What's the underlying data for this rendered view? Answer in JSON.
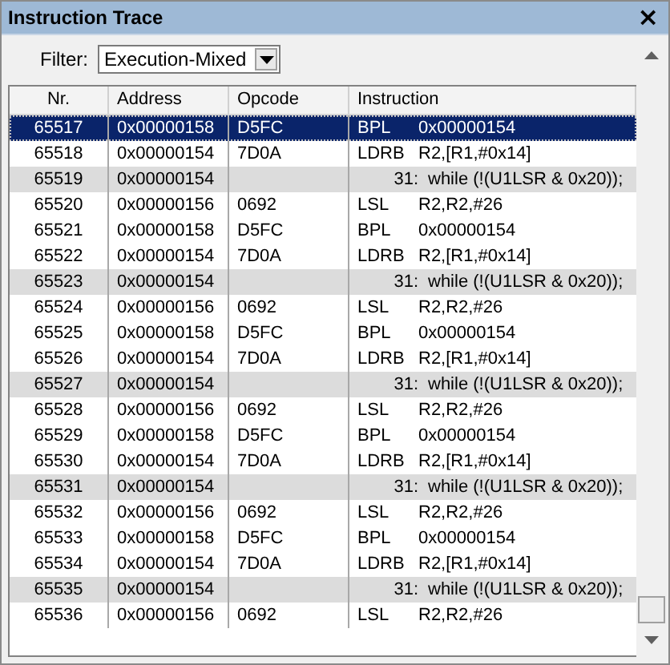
{
  "window": {
    "title": "Instruction Trace",
    "close": "×"
  },
  "filter": {
    "label": "Filter:",
    "value": "Execution-Mixed"
  },
  "table": {
    "columns": [
      "Nr.",
      "Address",
      "Opcode",
      "Instruction"
    ],
    "rows": [
      {
        "kind": "instr",
        "selected": true,
        "nr": "65517",
        "address": "0x00000158",
        "opcode": "D5FC",
        "mnemonic": "BPL",
        "operands": "0x00000154"
      },
      {
        "kind": "instr",
        "selected": false,
        "nr": "65518",
        "address": "0x00000154",
        "opcode": "7D0A",
        "mnemonic": "LDRB",
        "operands": "R2,[R1,#0x14]"
      },
      {
        "kind": "source",
        "selected": false,
        "nr": "65519",
        "address": "0x00000154",
        "line": "31:",
        "code": "while (!(U1LSR & 0x20));"
      },
      {
        "kind": "instr",
        "selected": false,
        "nr": "65520",
        "address": "0x00000156",
        "opcode": "0692",
        "mnemonic": "LSL",
        "operands": "R2,R2,#26"
      },
      {
        "kind": "instr",
        "selected": false,
        "nr": "65521",
        "address": "0x00000158",
        "opcode": "D5FC",
        "mnemonic": "BPL",
        "operands": "0x00000154"
      },
      {
        "kind": "instr",
        "selected": false,
        "nr": "65522",
        "address": "0x00000154",
        "opcode": "7D0A",
        "mnemonic": "LDRB",
        "operands": "R2,[R1,#0x14]"
      },
      {
        "kind": "source",
        "selected": false,
        "nr": "65523",
        "address": "0x00000154",
        "line": "31:",
        "code": "while (!(U1LSR & 0x20));"
      },
      {
        "kind": "instr",
        "selected": false,
        "nr": "65524",
        "address": "0x00000156",
        "opcode": "0692",
        "mnemonic": "LSL",
        "operands": "R2,R2,#26"
      },
      {
        "kind": "instr",
        "selected": false,
        "nr": "65525",
        "address": "0x00000158",
        "opcode": "D5FC",
        "mnemonic": "BPL",
        "operands": "0x00000154"
      },
      {
        "kind": "instr",
        "selected": false,
        "nr": "65526",
        "address": "0x00000154",
        "opcode": "7D0A",
        "mnemonic": "LDRB",
        "operands": "R2,[R1,#0x14]"
      },
      {
        "kind": "source",
        "selected": false,
        "nr": "65527",
        "address": "0x00000154",
        "line": "31:",
        "code": "while (!(U1LSR & 0x20));"
      },
      {
        "kind": "instr",
        "selected": false,
        "nr": "65528",
        "address": "0x00000156",
        "opcode": "0692",
        "mnemonic": "LSL",
        "operands": "R2,R2,#26"
      },
      {
        "kind": "instr",
        "selected": false,
        "nr": "65529",
        "address": "0x00000158",
        "opcode": "D5FC",
        "mnemonic": "BPL",
        "operands": "0x00000154"
      },
      {
        "kind": "instr",
        "selected": false,
        "nr": "65530",
        "address": "0x00000154",
        "opcode": "7D0A",
        "mnemonic": "LDRB",
        "operands": "R2,[R1,#0x14]"
      },
      {
        "kind": "source",
        "selected": false,
        "nr": "65531",
        "address": "0x00000154",
        "line": "31:",
        "code": "while (!(U1LSR & 0x20));"
      },
      {
        "kind": "instr",
        "selected": false,
        "nr": "65532",
        "address": "0x00000156",
        "opcode": "0692",
        "mnemonic": "LSL",
        "operands": "R2,R2,#26"
      },
      {
        "kind": "instr",
        "selected": false,
        "nr": "65533",
        "address": "0x00000158",
        "opcode": "D5FC",
        "mnemonic": "BPL",
        "operands": "0x00000154"
      },
      {
        "kind": "instr",
        "selected": false,
        "nr": "65534",
        "address": "0x00000154",
        "opcode": "7D0A",
        "mnemonic": "LDRB",
        "operands": "R2,[R1,#0x14]"
      },
      {
        "kind": "source",
        "selected": false,
        "nr": "65535",
        "address": "0x00000154",
        "line": "31:",
        "code": "while (!(U1LSR & 0x20));"
      },
      {
        "kind": "instr",
        "selected": false,
        "nr": "65536",
        "address": "0x00000156",
        "opcode": "0692",
        "mnemonic": "LSL",
        "operands": "R2,R2,#26"
      }
    ]
  }
}
